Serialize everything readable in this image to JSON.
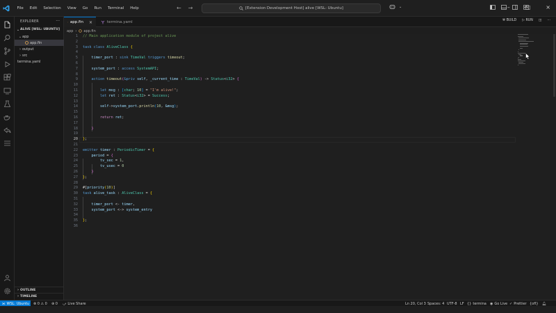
{
  "menu": [
    "File",
    "Edit",
    "Selection",
    "View",
    "Go",
    "Run",
    "Terminal",
    "Help"
  ],
  "search": {
    "text": "[Extension Development Host] alive [WSL: Ubuntu]"
  },
  "sidebar": {
    "title": "EXPLORER",
    "folder": "ALIVE [WSL: UBUNTU]",
    "items": [
      {
        "label": "app",
        "type": "folder-open"
      },
      {
        "label": "app.fin",
        "type": "file"
      },
      {
        "label": "output",
        "type": "folder"
      },
      {
        "label": "src",
        "type": "folder"
      },
      {
        "label": "termina.yaml",
        "type": "file"
      }
    ],
    "outline": "OUTLINE",
    "timeline": "TIMELINE"
  },
  "tabs": [
    {
      "label": "app.fin",
      "close": "×"
    },
    {
      "label": "termina.yaml"
    }
  ],
  "tab_actions": {
    "build": "BUILD",
    "run": "RUN"
  },
  "breadcrumb": [
    "app",
    "›",
    "app.fin"
  ],
  "editor": {
    "current_line": 20,
    "lines": [
      [
        [
          "// Main application module of project alive",
          "comment"
        ]
      ],
      [],
      [
        [
          "task class ",
          "kw"
        ],
        [
          "AliveClass",
          "type"
        ],
        [
          " {",
          "p1"
        ]
      ],
      [],
      [
        [
          "    timer_port",
          "var"
        ],
        [
          " : ",
          "txt"
        ],
        [
          "sink ",
          "kw"
        ],
        [
          "TimeVal ",
          "type"
        ],
        [
          "triggers ",
          "kw"
        ],
        [
          "timeout",
          "fn"
        ],
        [
          ";",
          "txt"
        ]
      ],
      [],
      [
        [
          "    system_port",
          "var"
        ],
        [
          " : ",
          "txt"
        ],
        [
          "access ",
          "kw"
        ],
        [
          "SystemAPI",
          "type"
        ],
        [
          ";",
          "txt"
        ]
      ],
      [],
      [
        [
          "    action ",
          "kw"
        ],
        [
          "timeout",
          "fn"
        ],
        [
          "(",
          "p2"
        ],
        [
          "&priv ",
          "kw"
        ],
        [
          "self",
          "var"
        ],
        [
          ", ",
          "txt"
        ],
        [
          "_current_time",
          "var"
        ],
        [
          " : ",
          "txt"
        ],
        [
          "TimeVal",
          "type"
        ],
        [
          ")",
          "p2"
        ],
        [
          " -> ",
          "txt"
        ],
        [
          "Status",
          "type"
        ],
        [
          "<",
          "txt"
        ],
        [
          "i32",
          "type"
        ],
        [
          ">",
          "txt"
        ],
        [
          " {",
          "p2"
        ]
      ],
      [],
      [
        [
          "        let ",
          "kw"
        ],
        [
          "msg",
          "var"
        ],
        [
          " : ",
          "txt"
        ],
        [
          "[",
          "p3"
        ],
        [
          "char",
          "type"
        ],
        [
          "; ",
          "txt"
        ],
        [
          "10",
          "num"
        ],
        [
          "]",
          "p3"
        ],
        [
          " = ",
          "txt"
        ],
        [
          "\"I'm alive!\"",
          "str"
        ],
        [
          ";",
          "txt"
        ]
      ],
      [
        [
          "        let ",
          "kw"
        ],
        [
          "ret",
          "var"
        ],
        [
          " : ",
          "txt"
        ],
        [
          "Status",
          "type"
        ],
        [
          "<",
          "txt"
        ],
        [
          "i32",
          "type"
        ],
        [
          ">",
          "txt"
        ],
        [
          " = ",
          "txt"
        ],
        [
          "Success",
          "type"
        ],
        [
          ";",
          "txt"
        ]
      ],
      [],
      [
        [
          "        self",
          "var"
        ],
        [
          "->",
          "txt"
        ],
        [
          "system_port",
          "var"
        ],
        [
          ".",
          "txt"
        ],
        [
          "println",
          "fn"
        ],
        [
          "(",
          "p3"
        ],
        [
          "10",
          "num"
        ],
        [
          ", ",
          "txt"
        ],
        [
          "&msg",
          "var"
        ],
        [
          ")",
          "p3"
        ],
        [
          ";",
          "txt"
        ]
      ],
      [],
      [
        [
          "        return ",
          "kw2"
        ],
        [
          "ret",
          "var"
        ],
        [
          ";",
          "txt"
        ]
      ],
      [],
      [
        [
          "    ",
          "txt"
        ],
        [
          "}",
          "p2"
        ]
      ],
      [],
      [
        [
          "}",
          "p1"
        ],
        [
          ";",
          "txt"
        ]
      ],
      [],
      [
        [
          "emitter ",
          "kw"
        ],
        [
          "timer",
          "var"
        ],
        [
          " : ",
          "txt"
        ],
        [
          "PeriodicTimer",
          "type"
        ],
        [
          " = ",
          "txt"
        ],
        [
          "{",
          "p1"
        ]
      ],
      [
        [
          "    period",
          "var"
        ],
        [
          " = ",
          "txt"
        ],
        [
          "{",
          "p2"
        ]
      ],
      [
        [
          "        tv_sec",
          "var"
        ],
        [
          " = ",
          "txt"
        ],
        [
          "1",
          "num"
        ],
        [
          ",",
          "txt"
        ]
      ],
      [
        [
          "        tv_usec",
          "var"
        ],
        [
          " = ",
          "txt"
        ],
        [
          "0",
          "num"
        ]
      ],
      [
        [
          "    ",
          "txt"
        ],
        [
          "}",
          "p2"
        ]
      ],
      [
        [
          "}",
          "p1"
        ],
        [
          ";",
          "txt"
        ]
      ],
      [],
      [
        [
          "#[",
          "txt"
        ],
        [
          "priority",
          "var"
        ],
        [
          "(",
          "p1"
        ],
        [
          "10",
          "num"
        ],
        [
          ")",
          "p1"
        ],
        [
          "]",
          "txt"
        ]
      ],
      [
        [
          "task ",
          "kw"
        ],
        [
          "alive_task",
          "var"
        ],
        [
          " : ",
          "txt"
        ],
        [
          "AliveClass",
          "type"
        ],
        [
          " = ",
          "txt"
        ],
        [
          "{",
          "p1"
        ]
      ],
      [],
      [
        [
          "    timer_port",
          "var"
        ],
        [
          " <- ",
          "txt"
        ],
        [
          "timer",
          "var"
        ],
        [
          ",",
          "txt"
        ]
      ],
      [
        [
          "    system_port",
          "var"
        ],
        [
          " <-> ",
          "txt"
        ],
        [
          "system_entry",
          "var"
        ]
      ],
      [],
      [
        [
          "}",
          "p1"
        ],
        [
          ";",
          "txt"
        ]
      ],
      []
    ]
  },
  "statusbar": {
    "remote": "WSL: Ubuntu",
    "problems": "⊗ 0 ⚠ 0",
    "ports": "⊕ 0",
    "liveshare": "Live Share",
    "position": "Ln 20, Col 3",
    "spaces": "Spaces: 4",
    "encoding": "UTF-8",
    "eol": "LF",
    "language": "termina",
    "golive": "Go Live",
    "prettier": "Prettier",
    "pyenv": "{ofl}"
  }
}
